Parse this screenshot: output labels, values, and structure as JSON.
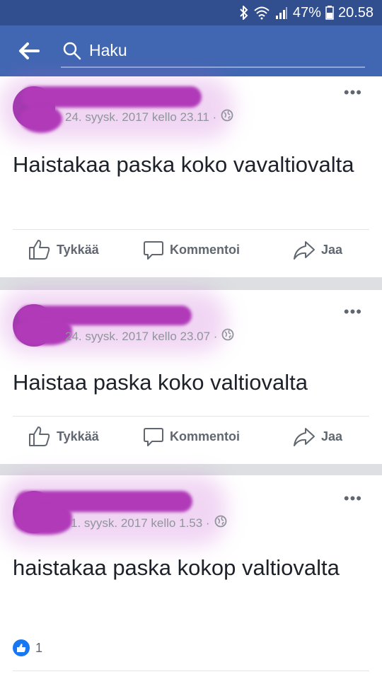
{
  "statusbar": {
    "battery": "47%",
    "time": "20.58"
  },
  "navbar": {
    "search_label": "Haku"
  },
  "posts": [
    {
      "timestamp": "24. syysk. 2017 kello 23.11 ·",
      "text": "Haistakaa paska koko vavaltiovalta",
      "like_label": "Tykkää",
      "comment_label": "Kommentoi",
      "share_label": "Jaa"
    },
    {
      "timestamp": "24. syysk. 2017 kello 23.07 ·",
      "text": "Haistaa paska koko valtiovalta",
      "like_label": "Tykkää",
      "comment_label": "Kommentoi",
      "share_label": "Jaa"
    },
    {
      "timestamp": "1. syysk. 2017 kello 1.53 ·",
      "text": "haistakaa paska kokop valtiovalta",
      "reaction_count": "1"
    }
  ],
  "icons": [
    "bluetooth-icon",
    "wifi-icon",
    "signal-icon",
    "battery-icon",
    "back-arrow-icon",
    "search-icon",
    "globe-icon",
    "more-icon",
    "like-icon",
    "comment-icon",
    "share-icon",
    "like-reaction-icon"
  ],
  "colors": {
    "status_bar": "#314f8f",
    "nav_bar": "#4267b2",
    "redaction": "#b03ab8",
    "like_blue": "#1877f2"
  }
}
